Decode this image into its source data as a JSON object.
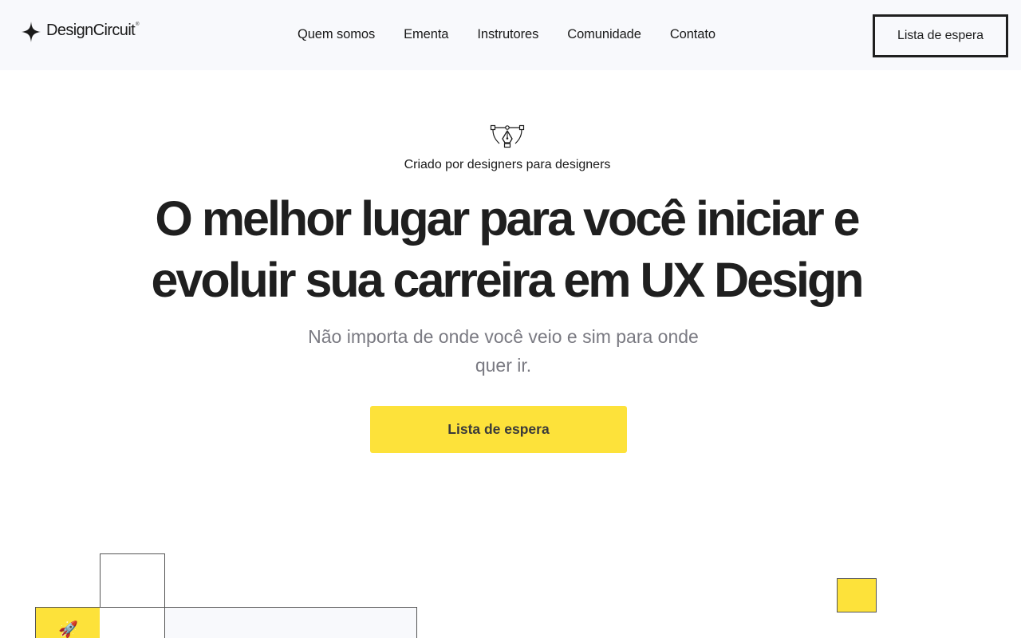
{
  "header": {
    "logo_text": "DesignCircuit",
    "logo_mark": "®",
    "nav": [
      {
        "label": "Quem somos"
      },
      {
        "label": "Ementa"
      },
      {
        "label": "Instrutores"
      },
      {
        "label": "Comunidade"
      },
      {
        "label": "Contato"
      }
    ],
    "cta_label": "Lista de espera"
  },
  "hero": {
    "icon": "pen-tool-icon",
    "eyebrow": "Criado por designers para designers",
    "headline_line1": "O melhor lugar para você iniciar e",
    "headline_line2": "evoluir sua carreira em UX Design",
    "subtitle": "Não importa de onde você veio e sim para onde quer ir.",
    "cta_label": "Lista de espera"
  },
  "decor": {
    "rocket_icon": "rocket-icon",
    "rocket_glyph": "🚀"
  },
  "colors": {
    "accent": "#fde23a",
    "header_bg": "#f8f9fc",
    "text": "#1f1f1f",
    "muted": "#7a7a82"
  }
}
